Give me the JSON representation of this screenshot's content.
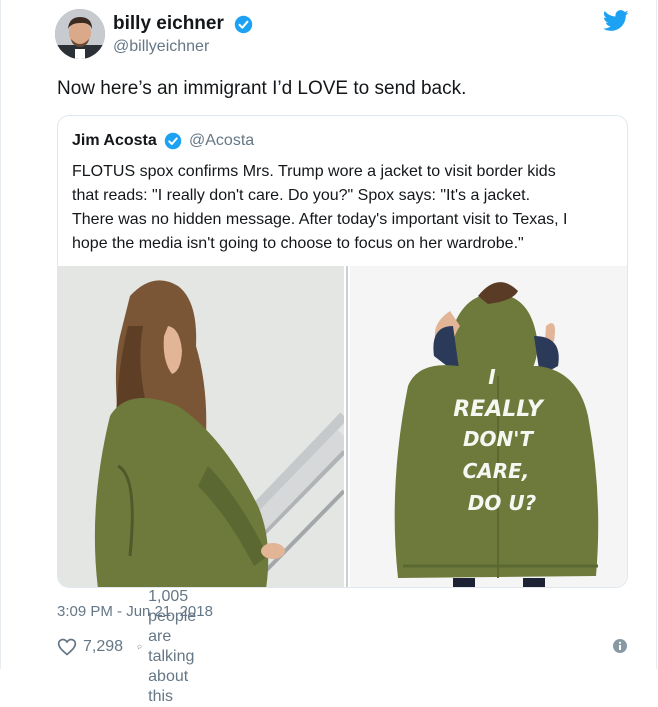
{
  "tweet": {
    "author": {
      "name": "billy eichner",
      "handle": "@billyeichner",
      "verified": true
    },
    "text": "Now here’s an immigrant I’d LOVE to send back.",
    "timestamp": "3:09 PM - Jun 21, 2018",
    "likes": "7,298",
    "talking": "1,005 people are talking about this"
  },
  "quoted": {
    "author": {
      "name": "Jim Acosta",
      "handle": "@Acosta",
      "verified": true
    },
    "lines": [
      "FLOTUS spox confirms Mrs. Trump wore a jacket to visit border kids",
      "that reads: \"I really don't care. Do you?\" Spox says: \"It's a jacket.",
      "There was no hidden message. After today's important visit to Texas, I",
      "hope the media isn't going to choose to focus on her wardrobe.\""
    ],
    "jacket_lettering": [
      "I",
      "REALLY",
      "DON'T",
      "CARE,",
      "DO U?"
    ]
  },
  "colors": {
    "twitter_blue": "#1da1f2",
    "jacket_green": "#6d7a3c",
    "muted_text": "#657786",
    "border": "#e1e8ed"
  },
  "icons": [
    "twitter-bird-icon",
    "verified-badge-icon",
    "heart-icon",
    "comment-icon",
    "info-icon"
  ]
}
